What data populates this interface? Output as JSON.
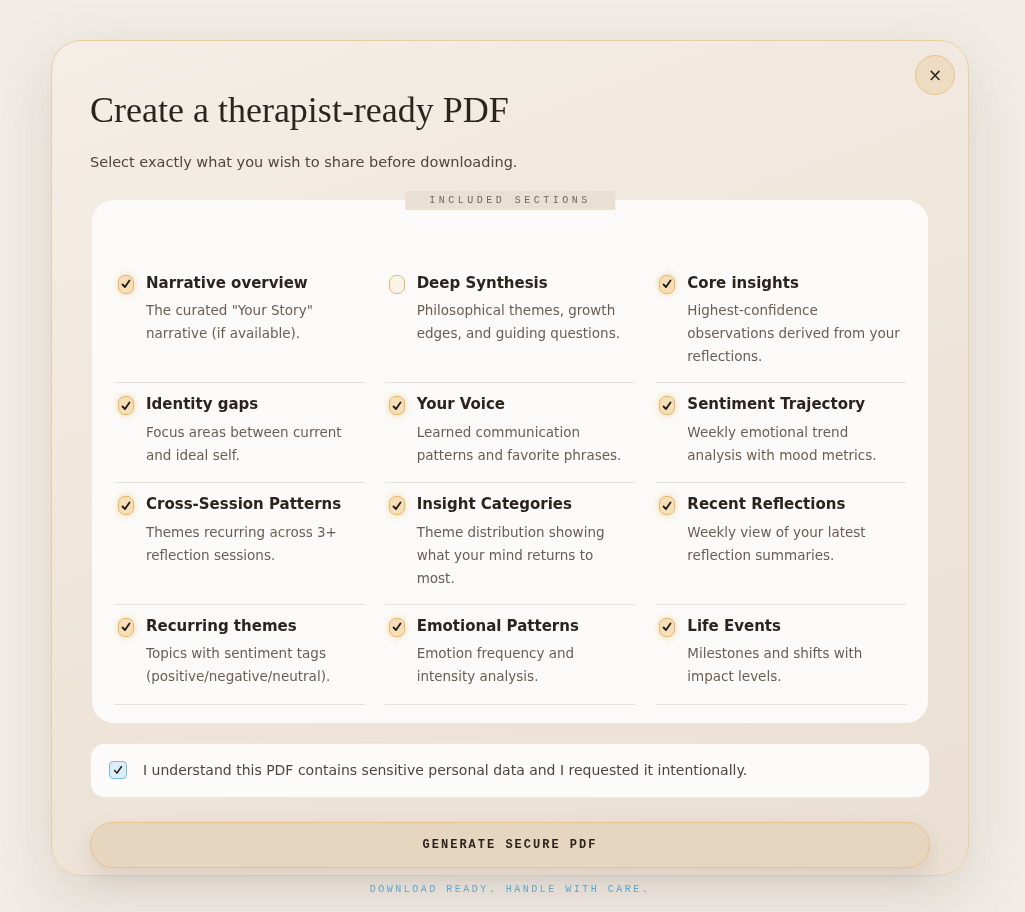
{
  "dialog": {
    "title": "Create a therapist-ready PDF",
    "subtitle": "Select exactly what you wish to share before downloading.",
    "close_label": "×"
  },
  "sections": {
    "legend": "INCLUDED SECTIONS",
    "items": [
      {
        "title": "Narrative overview",
        "description": "The curated \"Your Story\" narrative (if available).",
        "checked": true
      },
      {
        "title": "Deep Synthesis",
        "description": "Philosophical themes, growth edges, and guiding questions.",
        "checked": false
      },
      {
        "title": "Core insights",
        "description": "Highest-confidence observations derived from your reflections.",
        "checked": true
      },
      {
        "title": "Identity gaps",
        "description": "Focus areas between current and ideal self.",
        "checked": true
      },
      {
        "title": "Your Voice",
        "description": "Learned communication patterns and favorite phrases.",
        "checked": true
      },
      {
        "title": "Sentiment Trajectory",
        "description": "Weekly emotional trend analysis with mood metrics.",
        "checked": true
      },
      {
        "title": "Cross-Session Patterns",
        "description": "Themes recurring across 3+ reflection sessions.",
        "checked": true
      },
      {
        "title": "Insight Categories",
        "description": "Theme distribution showing what your mind returns to most.",
        "checked": true
      },
      {
        "title": "Recent Reflections",
        "description": "Weekly view of your latest reflection summaries.",
        "checked": true
      },
      {
        "title": "Recurring themes",
        "description": "Topics with sentiment tags (positive/negative/neutral).",
        "checked": true
      },
      {
        "title": "Emotional Patterns",
        "description": "Emotion frequency and intensity analysis.",
        "checked": true
      },
      {
        "title": "Life Events",
        "description": "Milestones and shifts with impact levels.",
        "checked": true
      }
    ]
  },
  "consent": {
    "label": "I understand this PDF contains sensitive personal data and I requested it intentionally.",
    "checked": true
  },
  "generate_button": "GENERATE SECURE PDF",
  "status": "DOWNLOAD READY. HANDLE WITH CARE."
}
